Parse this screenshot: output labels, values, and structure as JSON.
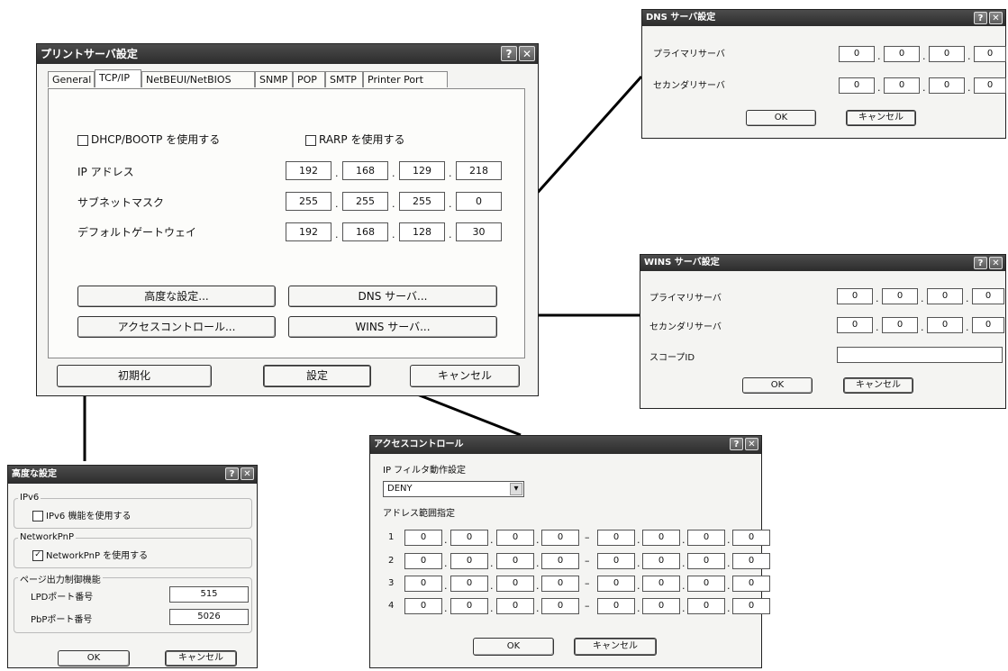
{
  "main": {
    "title": "プリントサーバ設定",
    "tabs": [
      "General",
      "TCP/IP",
      "NetBEUI/NetBIOS",
      "SNMP",
      "POP",
      "SMTP",
      "Printer Port"
    ],
    "dhcp_label": "DHCP/BOOTP を使用する",
    "rarp_label": "RARP を使用する",
    "ip_label": "IP アドレス",
    "ip": [
      "192",
      "168",
      "129",
      "218"
    ],
    "subnet_label": "サブネットマスク",
    "subnet": [
      "255",
      "255",
      "255",
      "0"
    ],
    "gateway_label": "デフォルトゲートウェイ",
    "gateway": [
      "192",
      "168",
      "128",
      "30"
    ],
    "advanced_btn": "高度な設定...",
    "dns_btn": "DNS サーバ...",
    "access_btn": "アクセスコントロール...",
    "wins_btn": "WINS サーバ...",
    "init_btn": "初期化",
    "set_btn": "設定",
    "cancel_btn": "キャンセル"
  },
  "dns": {
    "title": "DNS サーバ設定",
    "primary_label": "プライマリサーバ",
    "primary": [
      "0",
      "0",
      "0",
      "0"
    ],
    "secondary_label": "セカンダリサーバ",
    "secondary": [
      "0",
      "0",
      "0",
      "0"
    ],
    "ok": "OK",
    "cancel": "キャンセル"
  },
  "wins": {
    "title": "WINS サーバ設定",
    "primary_label": "プライマリサーバ",
    "primary": [
      "0",
      "0",
      "0",
      "0"
    ],
    "secondary_label": "セカンダリサーバ",
    "secondary": [
      "0",
      "0",
      "0",
      "0"
    ],
    "scope_label": "スコープID",
    "scope_value": "",
    "ok": "OK",
    "cancel": "キャンセル"
  },
  "advanced": {
    "title": "高度な設定",
    "ipv6_group": "IPv6",
    "ipv6_label": "IPv6 機能を使用する",
    "networkpnp_group": "NetworkPnP",
    "networkpnp_label": "NetworkPnP を使用する",
    "page_group": "ページ出力制御機能",
    "lpd_label": "LPDポート番号",
    "lpd_value": "515",
    "pbp_label": "PbPポート番号",
    "pbp_value": "5026",
    "ok": "OK",
    "cancel": "キャンセル"
  },
  "access": {
    "title": "アクセスコントロール",
    "filter_label": "IP フィルタ動作設定",
    "filter_value": "DENY",
    "range_label": "アドレス範囲指定",
    "rows": [
      {
        "num": "1",
        "from": [
          "0",
          "0",
          "0",
          "0"
        ],
        "to": [
          "0",
          "0",
          "0",
          "0"
        ]
      },
      {
        "num": "2",
        "from": [
          "0",
          "0",
          "0",
          "0"
        ],
        "to": [
          "0",
          "0",
          "0",
          "0"
        ]
      },
      {
        "num": "3",
        "from": [
          "0",
          "0",
          "0",
          "0"
        ],
        "to": [
          "0",
          "0",
          "0",
          "0"
        ]
      },
      {
        "num": "4",
        "from": [
          "0",
          "0",
          "0",
          "0"
        ],
        "to": [
          "0",
          "0",
          "0",
          "0"
        ]
      }
    ],
    "dash": "–",
    "ok": "OK",
    "cancel": "キャンセル"
  },
  "icons": {
    "help": "?",
    "close": "✕",
    "dropdown": "▾",
    "check": "✓"
  }
}
